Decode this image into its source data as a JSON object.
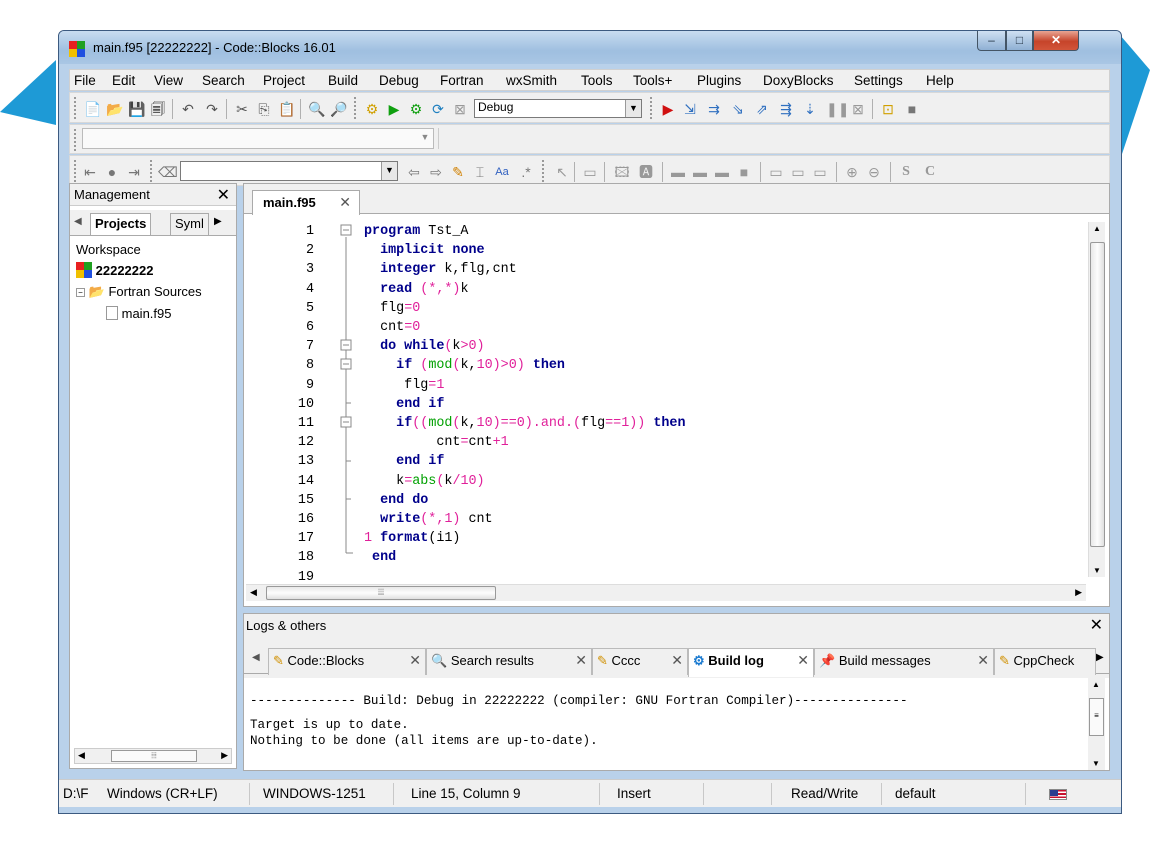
{
  "window": {
    "title": "main.f95 [22222222] - Code::Blocks 16.01"
  },
  "menu": [
    "File",
    "Edit",
    "View",
    "Search",
    "Project",
    "Build",
    "Debug",
    "Fortran",
    "wxSmith",
    "Tools",
    "Tools+",
    "Plugins",
    "DoxyBlocks",
    "Settings",
    "Help"
  ],
  "toolbar": {
    "build_target": "Debug"
  },
  "management": {
    "title": "Management",
    "tabs": [
      "Projects",
      "Syml"
    ],
    "tree": {
      "workspace": "Workspace",
      "project": "22222222",
      "folder": "Fortran Sources",
      "file": "main.f95"
    }
  },
  "editor": {
    "tab_label": "main.f95",
    "lines": [
      [
        [
          "kw",
          "program"
        ],
        [
          "t",
          " Tst_A"
        ]
      ],
      [
        [
          "t",
          "  "
        ],
        [
          "kw",
          "implicit"
        ],
        [
          "t",
          " "
        ],
        [
          "kw",
          "none"
        ]
      ],
      [
        [
          "t",
          "  "
        ],
        [
          "kw",
          "integer"
        ],
        [
          "t",
          " k,flg,cnt"
        ]
      ],
      [
        [
          "t",
          "  "
        ],
        [
          "kw",
          "read"
        ],
        [
          "t",
          " "
        ],
        [
          "nm",
          "(*,*)"
        ],
        [
          "t",
          "k"
        ]
      ],
      [
        [
          "t",
          "  flg"
        ],
        [
          "nm",
          "=0"
        ]
      ],
      [
        [
          "t",
          "  cnt"
        ],
        [
          "nm",
          "=0"
        ]
      ],
      [
        [
          "t",
          "  "
        ],
        [
          "kw",
          "do while"
        ],
        [
          "nm",
          "("
        ],
        [
          "t",
          "k"
        ],
        [
          "nm",
          ">0)"
        ]
      ],
      [
        [
          "t",
          "    "
        ],
        [
          "kw",
          "if"
        ],
        [
          "t",
          " "
        ],
        [
          "nm",
          "("
        ],
        [
          "fn",
          "mod"
        ],
        [
          "nm",
          "("
        ],
        [
          "t",
          "k,"
        ],
        [
          "nm",
          "10)>0)"
        ],
        [
          "t",
          " "
        ],
        [
          "kw",
          "then"
        ]
      ],
      [
        [
          "t",
          "     flg"
        ],
        [
          "nm",
          "=1"
        ]
      ],
      [
        [
          "t",
          "    "
        ],
        [
          "kw",
          "end if"
        ]
      ],
      [
        [
          "t",
          "    "
        ],
        [
          "kw",
          "if"
        ],
        [
          "nm",
          "(("
        ],
        [
          "fn",
          "mod"
        ],
        [
          "nm",
          "("
        ],
        [
          "t",
          "k,"
        ],
        [
          "nm",
          "10)==0).and.("
        ],
        [
          "t",
          "flg"
        ],
        [
          "nm",
          "==1))"
        ],
        [
          "t",
          " "
        ],
        [
          "kw",
          "then"
        ]
      ],
      [
        [
          "t",
          "         cnt"
        ],
        [
          "nm",
          "="
        ],
        [
          "t",
          "cnt"
        ],
        [
          "nm",
          "+1"
        ]
      ],
      [
        [
          "t",
          "    "
        ],
        [
          "kw",
          "end if"
        ]
      ],
      [
        [
          "t",
          "    k"
        ],
        [
          "nm",
          "="
        ],
        [
          "fn",
          "abs"
        ],
        [
          "nm",
          "("
        ],
        [
          "t",
          "k"
        ],
        [
          "nm",
          "/10)"
        ]
      ],
      [
        [
          "t",
          "  "
        ],
        [
          "kw",
          "end do"
        ]
      ],
      [
        [
          "t",
          "  "
        ],
        [
          "kw",
          "write"
        ],
        [
          "nm",
          "(*,1)"
        ],
        [
          "t",
          " cnt"
        ]
      ],
      [
        [
          "nm",
          "1"
        ],
        [
          "t",
          " "
        ],
        [
          "kw",
          "format"
        ],
        [
          "t",
          "(i1)"
        ]
      ],
      [
        [
          "t",
          " "
        ],
        [
          "kw",
          "end"
        ]
      ],
      [
        [
          "t",
          ""
        ]
      ]
    ]
  },
  "logs": {
    "title": "Logs & others",
    "tabs": [
      "Code::Blocks",
      "Search results",
      "Cccc",
      "Build log",
      "Build messages",
      "CppCheck"
    ],
    "active_tab": "Build log",
    "lines": [
      "-------------- Build: Debug in 22222222 (compiler: GNU Fortran Compiler)---------------",
      "Target is up to date.",
      "Nothing to be done (all items are up-to-date)."
    ]
  },
  "statusbar": {
    "path": "D:\\F",
    "eol": "Windows (CR+LF)",
    "encoding": "WINDOWS-1251",
    "position": "Line 15, Column 9",
    "mode": "Insert",
    "access": "Read/Write",
    "setting": "default"
  },
  "colors": {
    "keyword": "#00008b",
    "number": "#e0209a",
    "function": "#00a000"
  }
}
